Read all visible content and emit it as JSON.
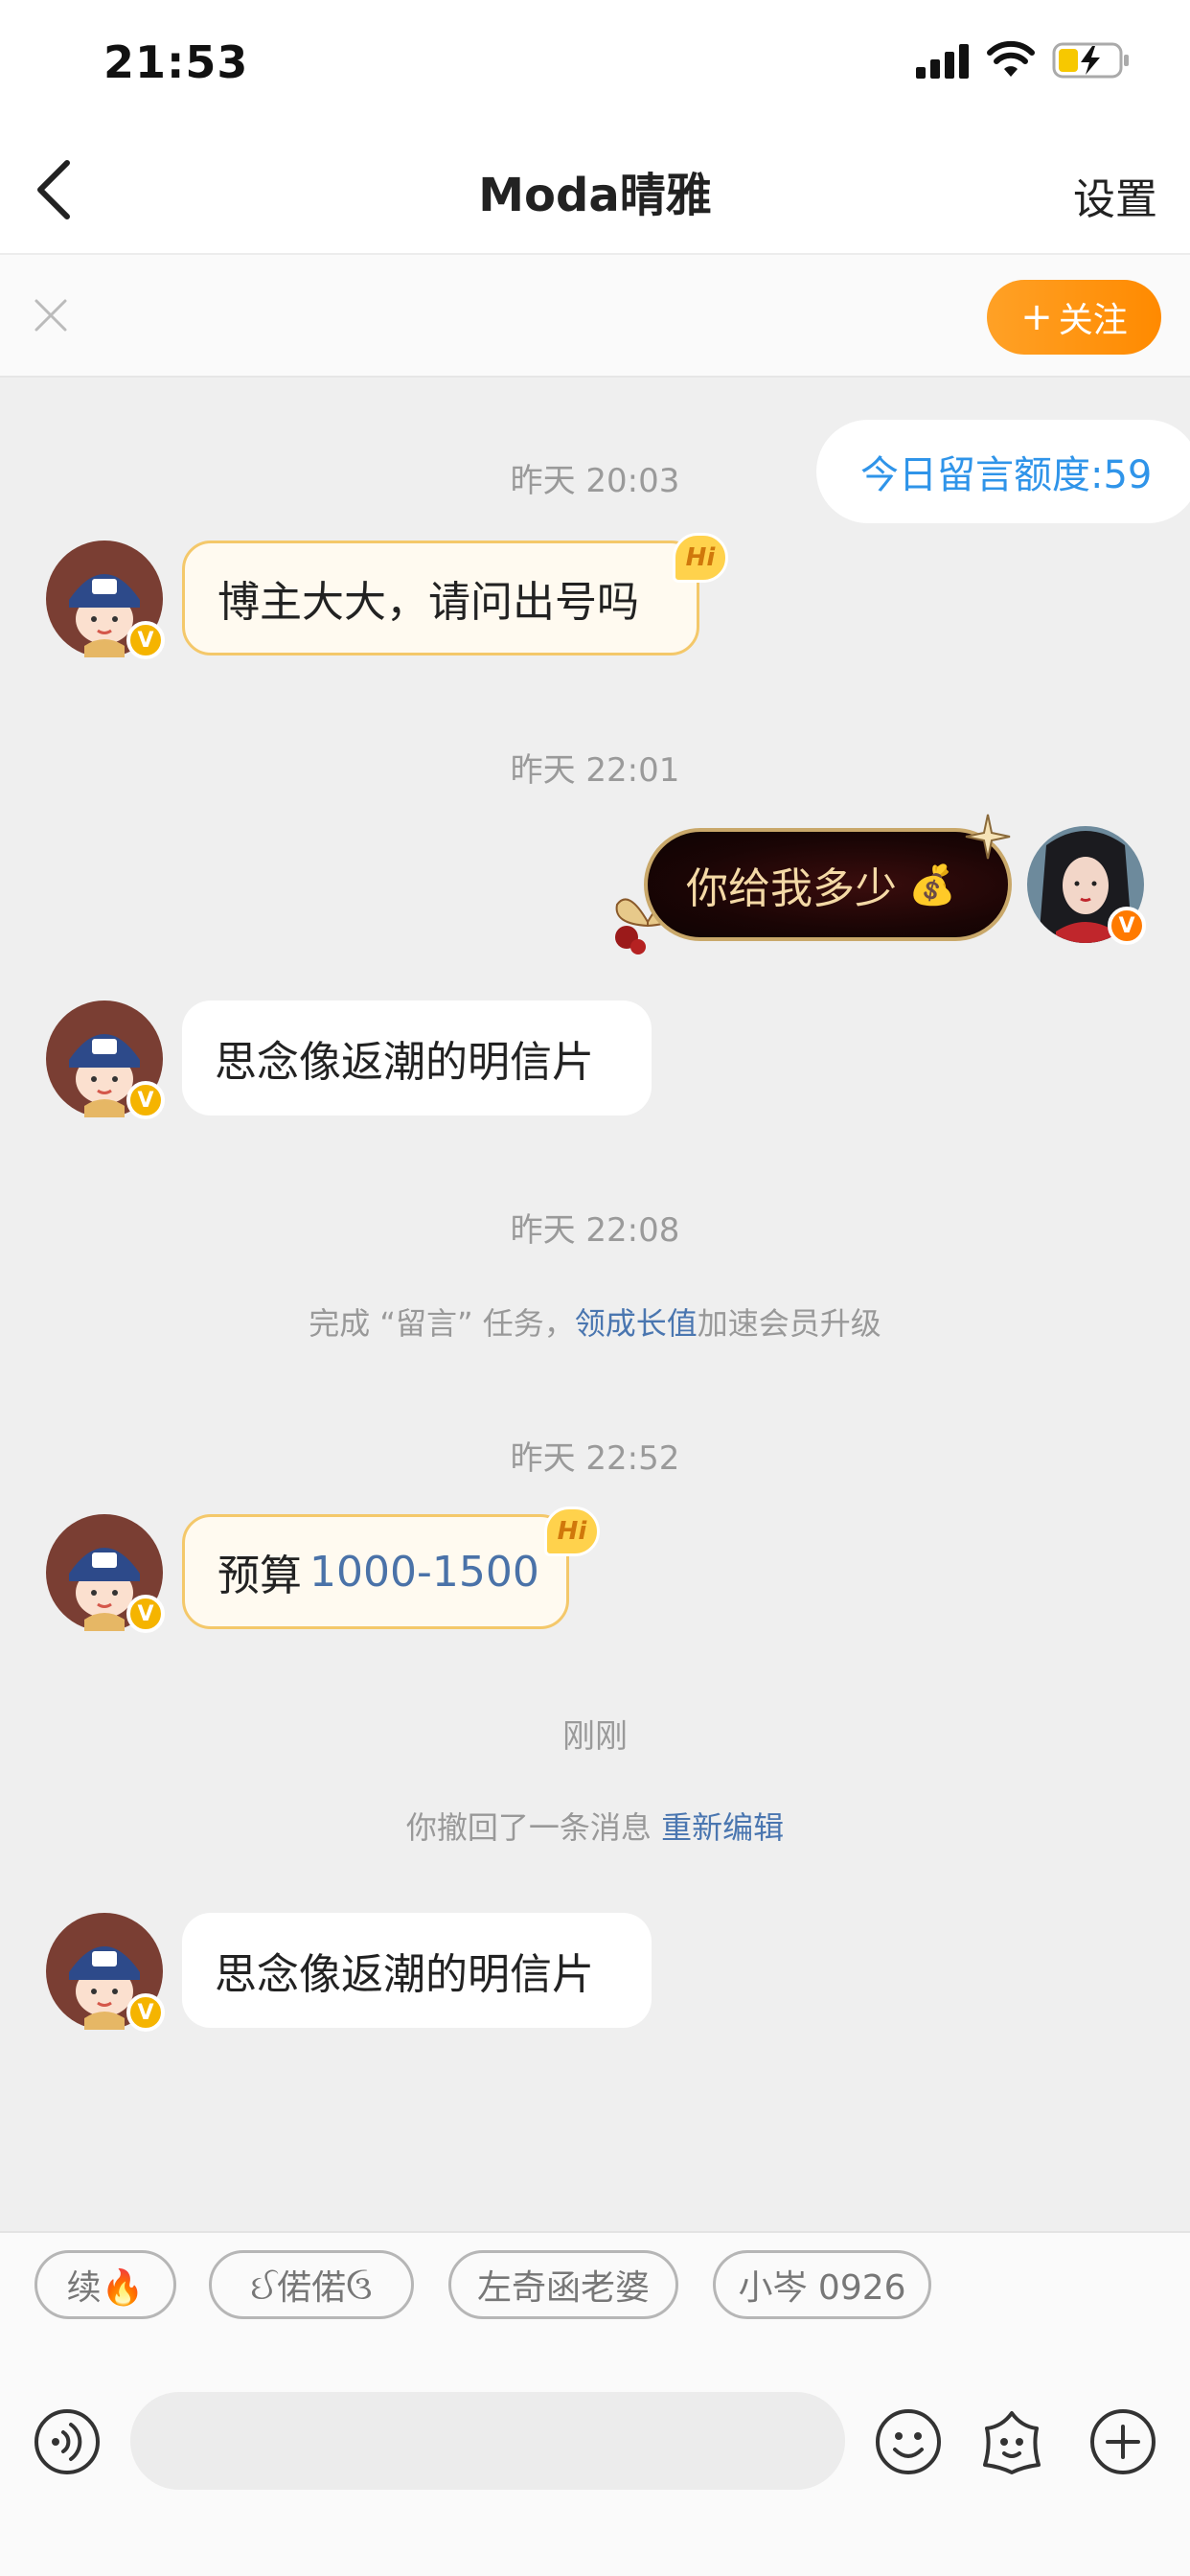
{
  "status_bar": {
    "time": "21:53",
    "icons": [
      "signal-icon",
      "wifi-icon",
      "battery-charging-icon"
    ]
  },
  "nav": {
    "back_icon": "chevron-left-icon",
    "title": "Moda晴雅",
    "settings_label": "设置"
  },
  "follow_bar": {
    "close_icon": "close-icon",
    "follow_label": "关注",
    "follow_plus": "+"
  },
  "quota": "今日留言额度:59",
  "messages": [
    {
      "type": "timestamp",
      "text": "昨天 20:03"
    },
    {
      "type": "incoming",
      "text": "博主大大，请问出号吗",
      "style": "hi"
    },
    {
      "type": "timestamp",
      "text": "昨天 22:01"
    },
    {
      "type": "outgoing",
      "text": "你给我多少",
      "emoji": "💰"
    },
    {
      "type": "incoming",
      "text": "思念像返潮的明信片"
    },
    {
      "type": "timestamp",
      "text": "昨天 22:08"
    },
    {
      "type": "notice",
      "prefix": "完成 “留言” 任务，",
      "link": "领成长值",
      "suffix": "加速会员升级"
    },
    {
      "type": "timestamp",
      "text": "昨天 22:52"
    },
    {
      "type": "incoming",
      "prefix": "预算",
      "highlight": "1000-1500",
      "style": "hi"
    },
    {
      "type": "timestamp",
      "text": "刚刚"
    },
    {
      "type": "notice",
      "prefix": "你撤回了一条消息 ",
      "link": "重新编辑",
      "suffix": ""
    },
    {
      "type": "incoming",
      "text": "思念像返潮的明信片"
    }
  ],
  "hi_badge": "Hi",
  "verified_badge": "V",
  "suggestions": [
    "续🔥",
    "ઈ偌偌ઉ",
    "左奇函老婆",
    "小岑 0926"
  ],
  "input": {
    "placeholder": "",
    "value": ""
  },
  "bottom_icons": [
    "voice-icon",
    "emoji-icon",
    "sticker-icon",
    "add-icon"
  ],
  "colors": {
    "accent": "#ff8a00",
    "link": "#4a76b0",
    "quota": "#2f94e9",
    "verified": "#f5b400"
  }
}
